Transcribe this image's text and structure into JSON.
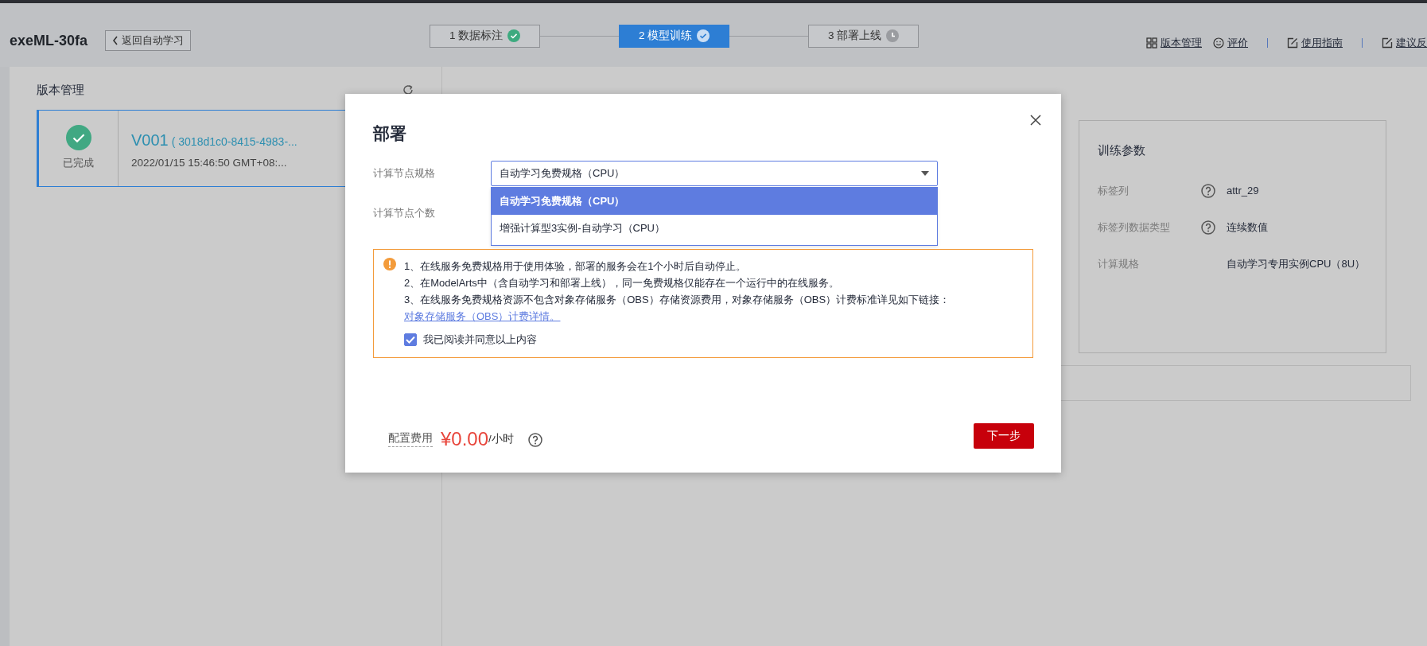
{
  "app_title": "exeML-30fa",
  "back_button": "返回自动学习",
  "steps": [
    {
      "label": "1 数据标注",
      "done": true,
      "selected": false
    },
    {
      "label": "2 模型训练",
      "done": true,
      "selected": true
    },
    {
      "label": "3 部署上线",
      "done": false,
      "selected": false
    }
  ],
  "header_links": [
    {
      "label": "版本管理",
      "kind": "grid"
    },
    {
      "label": "评价",
      "kind": "smile"
    },
    {
      "label": "使用指南",
      "kind": "edit"
    },
    {
      "label": "建议反",
      "kind": "edit"
    }
  ],
  "version_panel": {
    "title": "版本管理",
    "versions": [
      {
        "status": "已完成",
        "name": "V001",
        "id": "( 3018d1c0-8415-4983-...",
        "time": "2022/01/15 15:46:50 GMT+08:...",
        "selected": true
      }
    ]
  },
  "detail_panel": {
    "params_title": "训练参数",
    "params": [
      {
        "label": "标签列",
        "help": true,
        "value": "attr_29"
      },
      {
        "label": "标签列数据类型",
        "help": true,
        "value": "连续数值"
      },
      {
        "label": "计算规格",
        "help": false,
        "value": "自动学习专用实例CPU（8U）"
      }
    ]
  },
  "dialog": {
    "title": "部署",
    "fields": [
      {
        "label": "计算节点规格",
        "value": "自动学习免费规格（CPU）",
        "expanded": true,
        "options": [
          {
            "label": "自动学习免费规格（CPU）",
            "selected": true
          },
          {
            "label": "增强计算型3实例-自动学习（CPU）",
            "selected": false
          }
        ]
      },
      {
        "label": "计算节点个数"
      }
    ],
    "notice": {
      "lines": [
        "1、在线服务免费规格用于使用体验，部署的服务会在1个小时后自动停止。",
        "2、在ModelArts中（含自动学习和部署上线），同一免费规格仅能存在一个运行中的在线服务。",
        "3、在线服务免费规格资源不包含对象存储服务（OBS）存储资源费用，对象存储服务（OBS）计费标准详见如下链接："
      ],
      "link": "对象存储服务（OBS）计费详情。",
      "agree": {
        "label": "我已阅读并同意以上内容",
        "checked": true
      }
    },
    "cost_label": "配置费用",
    "price": "¥0.00",
    "unit": "/小时",
    "next_button": "下一步"
  }
}
